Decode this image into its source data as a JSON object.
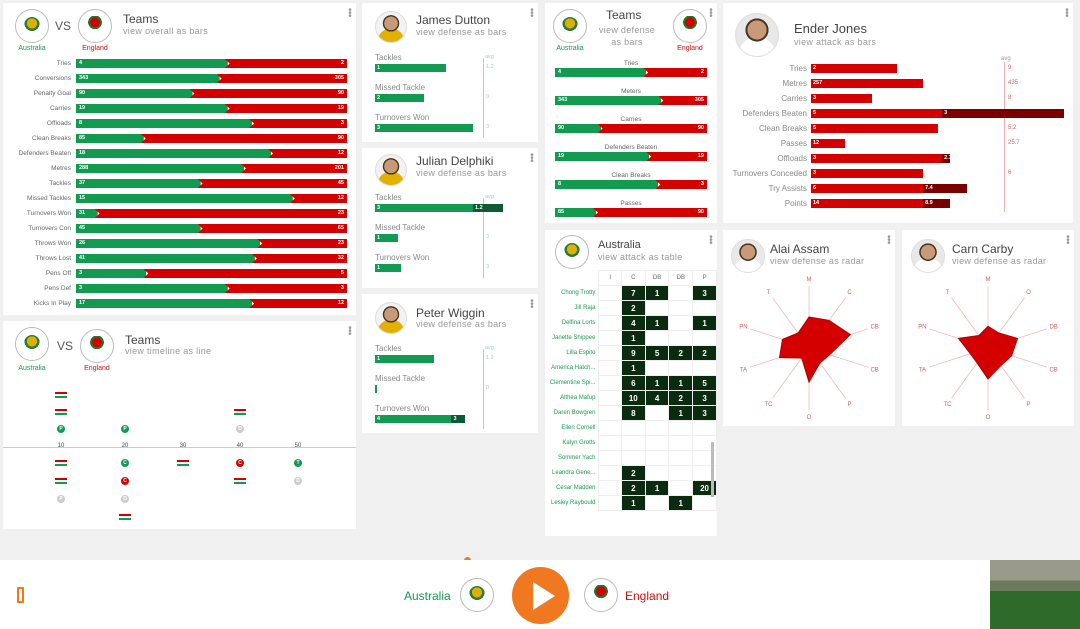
{
  "teams": {
    "home": "Australia",
    "away": "England",
    "vs": "VS"
  },
  "overall": {
    "title": "Teams",
    "subtitle": "view  overall  as  bars",
    "rows": [
      {
        "label": "Tries",
        "home": 4,
        "away": 2,
        "split": 0.56
      },
      {
        "label": "Conversions",
        "home": 343,
        "away": 305,
        "split": 0.53
      },
      {
        "label": "Penalty Goal",
        "home": 90,
        "away": 90,
        "split": 0.43
      },
      {
        "label": "Carries",
        "home": 19,
        "away": 19,
        "split": 0.56
      },
      {
        "label": "Offloads",
        "home": 8,
        "away": 3,
        "split": 0.65
      },
      {
        "label": "Clean Breaks",
        "home": 85,
        "away": 90,
        "split": 0.25
      },
      {
        "label": "Defenders Beaten",
        "home": 18,
        "away": 12,
        "split": 0.72
      },
      {
        "label": "Metres",
        "home": 288,
        "away": 201,
        "split": 0.62
      },
      {
        "label": "Tackles",
        "home": 37,
        "away": 45,
        "split": 0.46
      },
      {
        "label": "Missed Tackles",
        "home": 15,
        "away": 12,
        "split": 0.8
      },
      {
        "label": "Turnovers Won",
        "home": 31,
        "away": 23,
        "split": 0.08
      },
      {
        "label": "Turnovers Con",
        "home": 45,
        "away": 65,
        "split": 0.46
      },
      {
        "label": "Throws Won",
        "home": 26,
        "away": 23,
        "split": 0.68
      },
      {
        "label": "Throws Lost",
        "home": 41,
        "away": 32,
        "split": 0.66
      },
      {
        "label": "Pens Off",
        "home": 3,
        "away": 5,
        "split": 0.26
      },
      {
        "label": "Pens Def",
        "home": 3,
        "away": 3,
        "split": 0.56
      },
      {
        "label": "Kicks In Play",
        "home": 17,
        "away": 12,
        "split": 0.65
      }
    ]
  },
  "timeline": {
    "title": "Teams",
    "subtitle": "view  timeline  as  line",
    "ticks": [
      "10",
      "20",
      "30",
      "40",
      "50"
    ],
    "events_top": [
      {
        "col": 0,
        "row": 0,
        "type": "arr"
      },
      {
        "col": 0,
        "row": 1,
        "type": "arr"
      },
      {
        "col": 0,
        "row": 2,
        "type": "g",
        "t": "P"
      },
      {
        "col": 1,
        "row": 2,
        "type": "g",
        "t": "P"
      },
      {
        "col": 3,
        "row": 1,
        "type": "arr"
      },
      {
        "col": 3,
        "row": 2,
        "type": "x",
        "t": "D"
      }
    ],
    "events_bottom": [
      {
        "col": 0,
        "row": 0,
        "type": "arr"
      },
      {
        "col": 0,
        "row": 1,
        "type": "arr"
      },
      {
        "col": 0,
        "row": 2,
        "type": "x",
        "t": "P"
      },
      {
        "col": 1,
        "row": 0,
        "type": "g",
        "t": "C"
      },
      {
        "col": 1,
        "row": 1,
        "type": "r",
        "t": "C"
      },
      {
        "col": 1,
        "row": 2,
        "type": "x",
        "t": "D"
      },
      {
        "col": 1,
        "row": 3,
        "type": "arr"
      },
      {
        "col": 2,
        "row": 0,
        "type": "arr"
      },
      {
        "col": 3,
        "row": 0,
        "type": "r",
        "t": "C"
      },
      {
        "col": 3,
        "row": 1,
        "type": "arr"
      },
      {
        "col": 4,
        "row": 0,
        "type": "g",
        "t": "T"
      },
      {
        "col": 4,
        "row": 1,
        "type": "x",
        "t": "D"
      }
    ]
  },
  "players_defense": [
    {
      "name": "James Dutton",
      "subtitle": "view  defense  as  bars",
      "avg": "avg",
      "stats": [
        {
          "label": "Tackles",
          "value": 1,
          "avg": "1.2",
          "fill": 0.72
        },
        {
          "label": "Missed Tackle",
          "value": 2,
          "avg": "0",
          "fill": 0.5
        },
        {
          "label": "Turnovers Won",
          "value": 3,
          "avg": "3",
          "fill": 1.0
        }
      ]
    },
    {
      "name": "Julian Delphiki",
      "subtitle": "view  defense  as  bars",
      "avg": "avg",
      "stats": [
        {
          "label": "Tackles",
          "value": 3,
          "avg": "1.2",
          "fill": 1.0,
          "ext": "1.2"
        },
        {
          "label": "Missed Tackle",
          "value": 1,
          "avg": "3",
          "fill": 0.23
        },
        {
          "label": "Turnovers Won",
          "value": 1,
          "avg": "3",
          "fill": 0.27
        }
      ]
    },
    {
      "name": "Peter Wiggin",
      "subtitle": "view  defense  as  bars",
      "avg": "avg",
      "stats": [
        {
          "label": "Tackles",
          "value": 1,
          "avg": "1.2",
          "fill": 0.6
        },
        {
          "label": "Missed Tackle",
          "value": 0,
          "avg": "0",
          "fill": 0.02
        },
        {
          "label": "Turnovers Won",
          "value": 4,
          "avg": "3",
          "fill": 0.78,
          "ext": "3"
        }
      ]
    }
  ],
  "attack": {
    "title": "Teams",
    "subtitle": "view  defense  as  bars",
    "rows": [
      {
        "label": "Tries",
        "home": 4,
        "away": 2,
        "split": 0.6
      },
      {
        "label": "Meters",
        "home": 343,
        "away": 305,
        "split": 0.7
      },
      {
        "label": "Carries",
        "home": 90,
        "away": 90,
        "split": 0.3
      },
      {
        "label": "Defenders Beaten",
        "home": 19,
        "away": 19,
        "split": 0.62
      },
      {
        "label": "Clean Breaks",
        "home": 8,
        "away": 3,
        "split": 0.68
      },
      {
        "label": "Passes",
        "home": 85,
        "away": 90,
        "split": 0.27
      }
    ]
  },
  "table": {
    "title": "Australia",
    "subtitle": "view  attack  as  table",
    "cols": [
      "I",
      "C",
      "DB",
      "DB",
      "P"
    ],
    "rows": [
      {
        "name": "Chong Trotty",
        "cells": [
          "",
          "7",
          "1",
          "",
          "3"
        ]
      },
      {
        "name": "Jill Raja",
        "cells": [
          "",
          "2",
          "",
          "",
          ""
        ]
      },
      {
        "name": "Delfina Lorts",
        "cells": [
          "",
          "4",
          "1",
          "",
          "1"
        ]
      },
      {
        "name": "Janette Shippee",
        "cells": [
          "",
          "1",
          "",
          "",
          ""
        ]
      },
      {
        "name": "Lilla Espito",
        "cells": [
          "",
          "9",
          "5",
          "2",
          "2"
        ]
      },
      {
        "name": "America Hatch...",
        "cells": [
          "",
          "1",
          "",
          "",
          ""
        ]
      },
      {
        "name": "Clementine Spi...",
        "cells": [
          "",
          "6",
          "1",
          "1",
          "5"
        ]
      },
      {
        "name": "Althea Mafup",
        "cells": [
          "",
          "10",
          "4",
          "2",
          "3"
        ]
      },
      {
        "name": "Daren Bowgren",
        "cells": [
          "",
          "8",
          "",
          "1",
          "3"
        ]
      },
      {
        "name": "Ellen Cornell",
        "cells": [
          "",
          "",
          "",
          "",
          ""
        ]
      },
      {
        "name": "Kalyn Grotts",
        "cells": [
          "",
          "",
          "",
          "",
          ""
        ]
      },
      {
        "name": "Sommer Yach",
        "cells": [
          "",
          "",
          "",
          "",
          ""
        ]
      },
      {
        "name": "Leandra Gene...",
        "cells": [
          "",
          "2",
          "",
          "",
          ""
        ]
      },
      {
        "name": "Cesar Madden",
        "cells": [
          "",
          "2",
          "1",
          "",
          "20"
        ]
      },
      {
        "name": "Lesley Raybould",
        "cells": [
          "",
          "1",
          "",
          "1",
          ""
        ]
      }
    ]
  },
  "ender": {
    "name": "Ender Jones",
    "subtitle": "view  attack  as  bars",
    "avg": "avg",
    "stats": [
      {
        "label": "Tries",
        "value": 2,
        "avg": "9",
        "fill": 0.45
      },
      {
        "label": "Metres",
        "value": 257,
        "avg": "435",
        "fill": 0.59
      },
      {
        "label": "Carries",
        "value": 3,
        "avg": "8",
        "fill": 0.32
      },
      {
        "label": "Defenders Beaten",
        "value": 5,
        "avg": "3",
        "fill": 0.69,
        "ext": 1.0
      },
      {
        "label": "Clean Breaks",
        "value": 5,
        "avg": "5.2",
        "fill": 0.67
      },
      {
        "label": "Passes",
        "value": 12,
        "avg": "25.7",
        "fill": 0.18
      },
      {
        "label": "Offloads",
        "value": 3,
        "avg": "2.7",
        "fill": 0.69,
        "ext": 0.73
      },
      {
        "label": "Turnovers Conceded",
        "value": 3,
        "avg": "6",
        "fill": 0.59
      },
      {
        "label": "Try Assists",
        "value": 6,
        "avg": "7.4",
        "fill": 0.59,
        "ext": 0.82
      },
      {
        "label": "Points",
        "value": 14,
        "avg": "8.9",
        "fill": 0.59,
        "ext": 0.73
      }
    ]
  },
  "radar": [
    {
      "name": "Alai Assam",
      "subtitle": "view  defense  as  radar",
      "axes": [
        "M",
        "C",
        "CB",
        "CB",
        "P",
        "O",
        "TC",
        "TA",
        "PN",
        "T"
      ],
      "values": [
        0.5,
        0.55,
        0.7,
        0.35,
        0.3,
        0.55,
        0.2,
        0.5,
        0.45,
        0.3
      ]
    },
    {
      "name": "Carn Carby",
      "subtitle": "view  defense  as  radar",
      "axes": [
        "M",
        "O",
        "DB",
        "CB",
        "P",
        "O",
        "TC",
        "TA",
        "PN",
        "T"
      ],
      "values": [
        0.35,
        0.3,
        0.5,
        0.4,
        0.35,
        0.5,
        0.3,
        0.3,
        0.5,
        0.25
      ]
    }
  ],
  "player": {
    "home": "Australia",
    "away": "England",
    "progress": 0.432
  },
  "colors": {
    "green": "#119a50",
    "red": "#d40000",
    "orange": "#f07820"
  }
}
